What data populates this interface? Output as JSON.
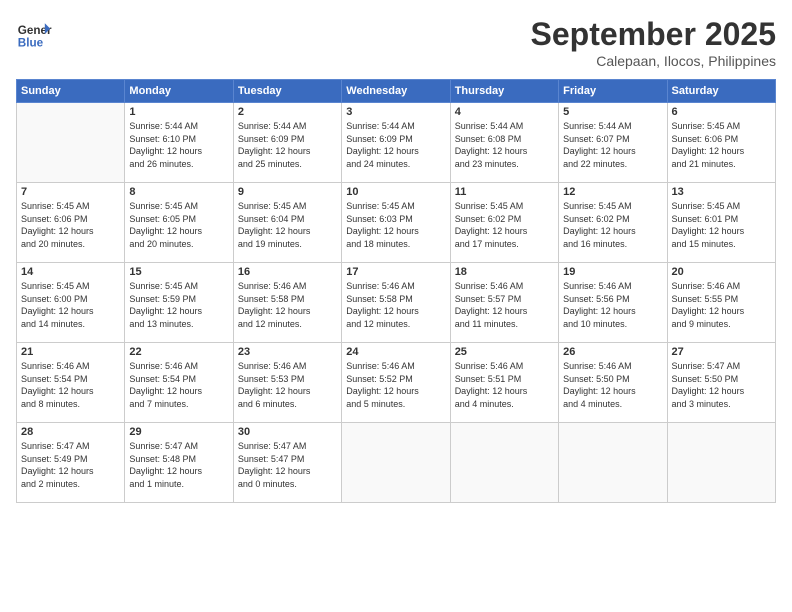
{
  "header": {
    "logo_line1": "General",
    "logo_line2": "Blue",
    "month": "September 2025",
    "location": "Calepaan, Ilocos, Philippines"
  },
  "weekdays": [
    "Sunday",
    "Monday",
    "Tuesday",
    "Wednesday",
    "Thursday",
    "Friday",
    "Saturday"
  ],
  "weeks": [
    [
      {
        "day": "",
        "info": ""
      },
      {
        "day": "1",
        "info": "Sunrise: 5:44 AM\nSunset: 6:10 PM\nDaylight: 12 hours\nand 26 minutes."
      },
      {
        "day": "2",
        "info": "Sunrise: 5:44 AM\nSunset: 6:09 PM\nDaylight: 12 hours\nand 25 minutes."
      },
      {
        "day": "3",
        "info": "Sunrise: 5:44 AM\nSunset: 6:09 PM\nDaylight: 12 hours\nand 24 minutes."
      },
      {
        "day": "4",
        "info": "Sunrise: 5:44 AM\nSunset: 6:08 PM\nDaylight: 12 hours\nand 23 minutes."
      },
      {
        "day": "5",
        "info": "Sunrise: 5:44 AM\nSunset: 6:07 PM\nDaylight: 12 hours\nand 22 minutes."
      },
      {
        "day": "6",
        "info": "Sunrise: 5:45 AM\nSunset: 6:06 PM\nDaylight: 12 hours\nand 21 minutes."
      }
    ],
    [
      {
        "day": "7",
        "info": "Sunrise: 5:45 AM\nSunset: 6:06 PM\nDaylight: 12 hours\nand 20 minutes."
      },
      {
        "day": "8",
        "info": "Sunrise: 5:45 AM\nSunset: 6:05 PM\nDaylight: 12 hours\nand 20 minutes."
      },
      {
        "day": "9",
        "info": "Sunrise: 5:45 AM\nSunset: 6:04 PM\nDaylight: 12 hours\nand 19 minutes."
      },
      {
        "day": "10",
        "info": "Sunrise: 5:45 AM\nSunset: 6:03 PM\nDaylight: 12 hours\nand 18 minutes."
      },
      {
        "day": "11",
        "info": "Sunrise: 5:45 AM\nSunset: 6:02 PM\nDaylight: 12 hours\nand 17 minutes."
      },
      {
        "day": "12",
        "info": "Sunrise: 5:45 AM\nSunset: 6:02 PM\nDaylight: 12 hours\nand 16 minutes."
      },
      {
        "day": "13",
        "info": "Sunrise: 5:45 AM\nSunset: 6:01 PM\nDaylight: 12 hours\nand 15 minutes."
      }
    ],
    [
      {
        "day": "14",
        "info": "Sunrise: 5:45 AM\nSunset: 6:00 PM\nDaylight: 12 hours\nand 14 minutes."
      },
      {
        "day": "15",
        "info": "Sunrise: 5:45 AM\nSunset: 5:59 PM\nDaylight: 12 hours\nand 13 minutes."
      },
      {
        "day": "16",
        "info": "Sunrise: 5:46 AM\nSunset: 5:58 PM\nDaylight: 12 hours\nand 12 minutes."
      },
      {
        "day": "17",
        "info": "Sunrise: 5:46 AM\nSunset: 5:58 PM\nDaylight: 12 hours\nand 12 minutes."
      },
      {
        "day": "18",
        "info": "Sunrise: 5:46 AM\nSunset: 5:57 PM\nDaylight: 12 hours\nand 11 minutes."
      },
      {
        "day": "19",
        "info": "Sunrise: 5:46 AM\nSunset: 5:56 PM\nDaylight: 12 hours\nand 10 minutes."
      },
      {
        "day": "20",
        "info": "Sunrise: 5:46 AM\nSunset: 5:55 PM\nDaylight: 12 hours\nand 9 minutes."
      }
    ],
    [
      {
        "day": "21",
        "info": "Sunrise: 5:46 AM\nSunset: 5:54 PM\nDaylight: 12 hours\nand 8 minutes."
      },
      {
        "day": "22",
        "info": "Sunrise: 5:46 AM\nSunset: 5:54 PM\nDaylight: 12 hours\nand 7 minutes."
      },
      {
        "day": "23",
        "info": "Sunrise: 5:46 AM\nSunset: 5:53 PM\nDaylight: 12 hours\nand 6 minutes."
      },
      {
        "day": "24",
        "info": "Sunrise: 5:46 AM\nSunset: 5:52 PM\nDaylight: 12 hours\nand 5 minutes."
      },
      {
        "day": "25",
        "info": "Sunrise: 5:46 AM\nSunset: 5:51 PM\nDaylight: 12 hours\nand 4 minutes."
      },
      {
        "day": "26",
        "info": "Sunrise: 5:46 AM\nSunset: 5:50 PM\nDaylight: 12 hours\nand 4 minutes."
      },
      {
        "day": "27",
        "info": "Sunrise: 5:47 AM\nSunset: 5:50 PM\nDaylight: 12 hours\nand 3 minutes."
      }
    ],
    [
      {
        "day": "28",
        "info": "Sunrise: 5:47 AM\nSunset: 5:49 PM\nDaylight: 12 hours\nand 2 minutes."
      },
      {
        "day": "29",
        "info": "Sunrise: 5:47 AM\nSunset: 5:48 PM\nDaylight: 12 hours\nand 1 minute."
      },
      {
        "day": "30",
        "info": "Sunrise: 5:47 AM\nSunset: 5:47 PM\nDaylight: 12 hours\nand 0 minutes."
      },
      {
        "day": "",
        "info": ""
      },
      {
        "day": "",
        "info": ""
      },
      {
        "day": "",
        "info": ""
      },
      {
        "day": "",
        "info": ""
      }
    ]
  ]
}
